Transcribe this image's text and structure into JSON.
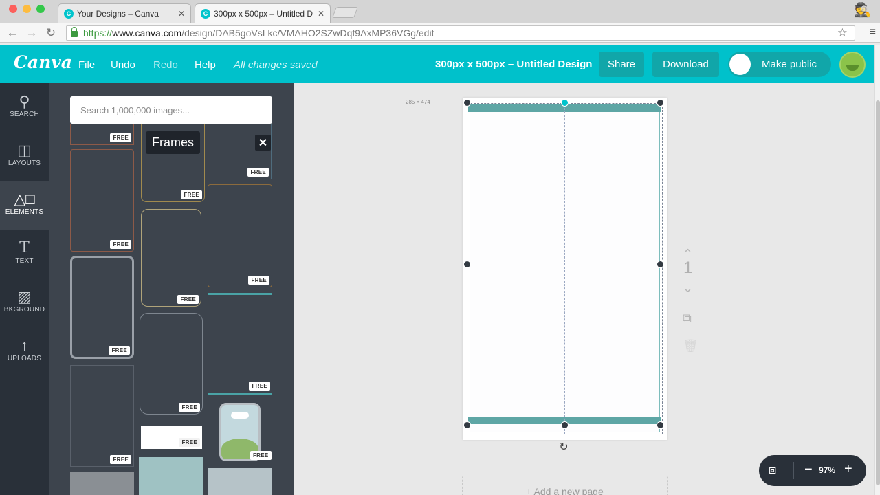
{
  "browser": {
    "tabs": [
      {
        "title": "Your Designs – Canva",
        "favicon": "C"
      },
      {
        "title": "300px x 500px – Untitled D",
        "favicon": "C"
      }
    ],
    "url": {
      "scheme": "https://",
      "host": "www.canva.com",
      "path": "/design/DAB5goVsLkc/VMAHO2SZwDqf9AxMP36VGg/edit"
    },
    "icons": {
      "back": "back-arrow-icon",
      "forward": "forward-arrow-icon",
      "reload": "reload-icon",
      "bookmark": "star-icon",
      "menu": "hamburger-icon",
      "incognito": "incognito-icon"
    }
  },
  "app": {
    "logo": "Canva",
    "menu": {
      "file": "File",
      "undo": "Undo",
      "redo": "Redo",
      "help": "Help"
    },
    "status": "All changes saved",
    "design_title": "300px x 500px – Untitled Design",
    "share": "Share",
    "download": "Download",
    "make_public": "Make public",
    "brand_color": "#00c1cb"
  },
  "sidebar": {
    "items": [
      {
        "label": "SEARCH",
        "icon": "search-icon"
      },
      {
        "label": "LAYOUTS",
        "icon": "layouts-icon"
      },
      {
        "label": "ELEMENTS",
        "icon": "shapes-icon",
        "active": true
      },
      {
        "label": "TEXT",
        "icon": "text-icon"
      },
      {
        "label": "BKGROUND",
        "icon": "background-icon"
      },
      {
        "label": "UPLOADS",
        "icon": "upload-arrow-icon"
      }
    ]
  },
  "panel": {
    "search_placeholder": "Search 1,000,000 images...",
    "tooltip": "Frames",
    "close": "✕",
    "badge": "FREE"
  },
  "canvas": {
    "dims_label": "285 × 474",
    "page_number": "1",
    "add_page": "+ Add a new page",
    "zoom": "97%",
    "zoom_minus": "−",
    "zoom_plus": "+"
  }
}
